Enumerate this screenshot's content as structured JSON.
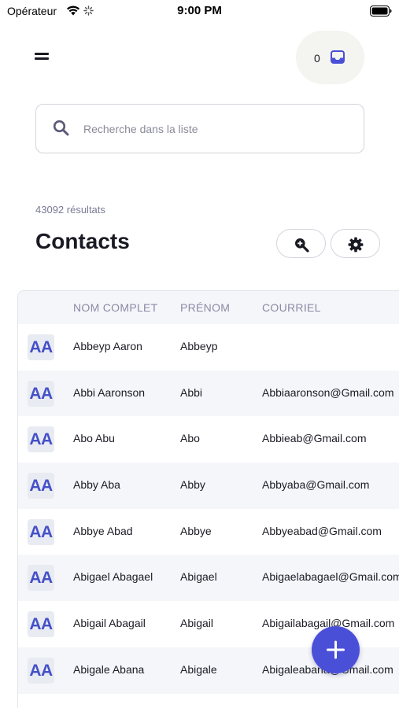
{
  "status_bar": {
    "carrier": "Opérateur",
    "time": "9:00 PM"
  },
  "header": {
    "inbox_count": "0"
  },
  "search": {
    "placeholder": "Recherche dans la liste",
    "value": ""
  },
  "results": {
    "count_label": "43092 résultats"
  },
  "page": {
    "title": "Contacts"
  },
  "table": {
    "columns": [
      "NOM COMPLET",
      "PRÉNOM",
      "COURRIEL"
    ],
    "rows": [
      {
        "avatar": "AA",
        "full_name": "Abbeyp Aaron",
        "first_name": "Abbeyp",
        "email": ""
      },
      {
        "avatar": "AA",
        "full_name": "Abbi Aaronson",
        "first_name": "Abbi",
        "email": "Abbiaaronson@Gmail.com"
      },
      {
        "avatar": "AA",
        "full_name": "Abo Abu",
        "first_name": "Abo",
        "email": "Abbieab@Gmail.com"
      },
      {
        "avatar": "AA",
        "full_name": "Abby Aba",
        "first_name": "Abby",
        "email": "Abbyaba@Gmail.com"
      },
      {
        "avatar": "AA",
        "full_name": "Abbye Abad",
        "first_name": "Abbye",
        "email": "Abbyeabad@Gmail.com"
      },
      {
        "avatar": "AA",
        "full_name": "Abigael Abagael",
        "first_name": "Abigael",
        "email": "Abigaelabagael@Gmail.com"
      },
      {
        "avatar": "AA",
        "full_name": "Abigail Abagail",
        "first_name": "Abigail",
        "email": "Abigailabagail@Gmail.com"
      },
      {
        "avatar": "AA",
        "full_name": "Abigale Abana",
        "first_name": "Abigale",
        "email": "Abigaleabana@Gmail.com"
      }
    ]
  },
  "icons": {
    "menu": "hamburger-icon",
    "inbox": "inbox-tray-icon",
    "search": "search-icon",
    "zoom": "search-plus-icon",
    "settings": "gear-icon",
    "add": "plus-icon"
  },
  "colors": {
    "accent": "#4a4fd8",
    "avatar_text": "#4450c8",
    "muted_text": "#8a8aa6",
    "row_alt": "#f5f6f9"
  }
}
